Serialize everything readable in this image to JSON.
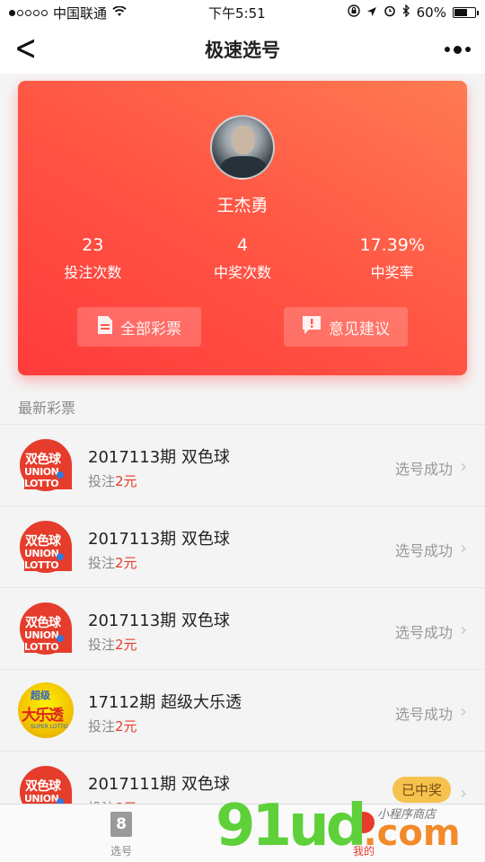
{
  "status_bar": {
    "carrier": "中国联通",
    "time": "下午5:51",
    "battery": "60%"
  },
  "nav": {
    "title": "极速选号"
  },
  "profile": {
    "name": "王杰勇",
    "stats": [
      {
        "value": "23",
        "label": "投注次数"
      },
      {
        "value": "4",
        "label": "中奖次数"
      },
      {
        "value": "17.39%",
        "label": "中奖率"
      }
    ],
    "buttons": {
      "all_tickets": "全部彩票",
      "feedback": "意见建议"
    }
  },
  "section": {
    "latest_title": "最新彩票"
  },
  "tickets": [
    {
      "title": "2017113期 双色球",
      "bet_label": "投注",
      "amount": "2元",
      "status": "选号成功",
      "logo": "ssq"
    },
    {
      "title": "2017113期 双色球",
      "bet_label": "投注",
      "amount": "2元",
      "status": "选号成功",
      "logo": "ssq"
    },
    {
      "title": "2017113期 双色球",
      "bet_label": "投注",
      "amount": "2元",
      "status": "选号成功",
      "logo": "ssq"
    },
    {
      "title": "17112期 超级大乐透",
      "bet_label": "投注",
      "amount": "2元",
      "status": "选号成功",
      "logo": "dlt"
    },
    {
      "title": "2017111期 双色球",
      "bet_label": "投注",
      "amount": "8元",
      "status": "已中奖",
      "logo": "ssq"
    }
  ],
  "logos": {
    "ssq_line1": "双色球",
    "ssq_line2": "UNION LOTTO",
    "dlt_line1": "超级",
    "dlt_line2": "大乐透",
    "dlt_line3": "SUPER LOTTO"
  },
  "tabbar": {
    "tab1_icon": "8",
    "tab1_label": "选号",
    "tab2_label": "我的"
  },
  "watermark": {
    "main": "91ud",
    "suffix": ".com",
    "sub": "小程序商店"
  },
  "colors": {
    "accent": "#e53c2b",
    "card_gradient_start": "#ff3b3b",
    "card_gradient_end": "#ff7b52",
    "win_badge": "#f5c24e"
  }
}
